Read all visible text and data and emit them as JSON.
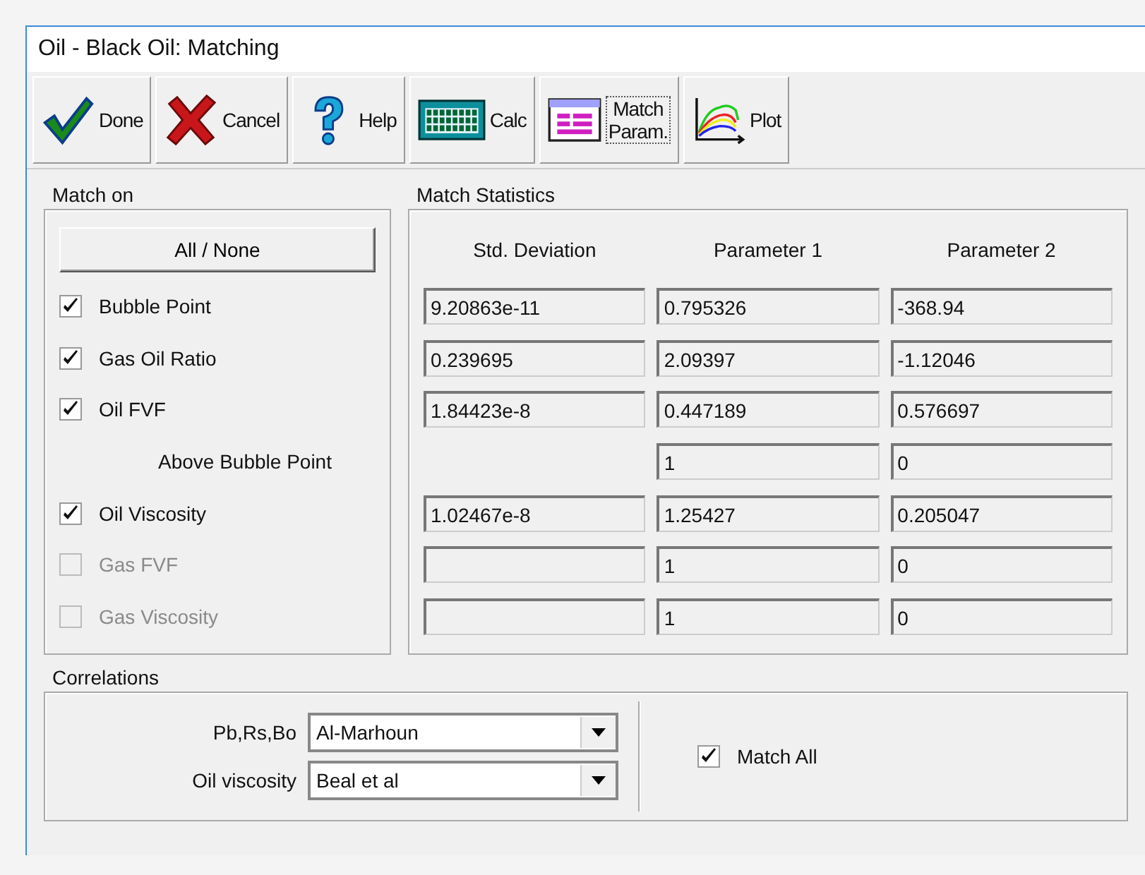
{
  "window": {
    "title": "Oil - Black Oil: Matching"
  },
  "toolbar": [
    {
      "kind": "done",
      "label": "Done"
    },
    {
      "kind": "cancel",
      "label": "Cancel"
    },
    {
      "kind": "help",
      "label": "Help"
    },
    {
      "kind": "calc",
      "label": "Calc"
    },
    {
      "kind": "param",
      "label_lines": [
        "Match",
        "Param."
      ]
    },
    {
      "kind": "plot",
      "label": "Plot"
    }
  ],
  "match_on": {
    "title": "Match on",
    "all_none_button": "All / None",
    "items": [
      {
        "kind": "checkbox",
        "label": "Bubble Point",
        "checked": true,
        "disabled": false
      },
      {
        "kind": "checkbox",
        "label": "Gas Oil Ratio",
        "checked": true,
        "disabled": false
      },
      {
        "kind": "checkbox",
        "label": "Oil FVF",
        "checked": true,
        "disabled": false
      },
      {
        "kind": "note",
        "label": "Above Bubble Point"
      },
      {
        "kind": "checkbox",
        "label": "Oil Viscosity",
        "checked": true,
        "disabled": false
      },
      {
        "kind": "checkbox",
        "label": "Gas FVF",
        "checked": false,
        "disabled": true
      },
      {
        "kind": "checkbox",
        "label": "Gas Viscosity",
        "checked": false,
        "disabled": true
      }
    ]
  },
  "match_statistics": {
    "title": "Match Statistics",
    "columns": [
      "Std. Deviation",
      "Parameter 1",
      "Parameter 2"
    ],
    "rows": [
      {
        "cells": [
          {
            "kind": "field",
            "value": "9.20863e-11"
          },
          {
            "kind": "field",
            "value": "0.795326"
          },
          {
            "kind": "field",
            "value": "-368.94"
          }
        ]
      },
      {
        "cells": [
          {
            "kind": "field",
            "value": "0.239695"
          },
          {
            "kind": "field",
            "value": "2.09397"
          },
          {
            "kind": "field",
            "value": "-1.12046"
          }
        ]
      },
      {
        "cells": [
          {
            "kind": "field",
            "value": "1.84423e-8"
          },
          {
            "kind": "field",
            "value": "0.447189"
          },
          {
            "kind": "field",
            "value": "0.576697"
          }
        ]
      },
      {
        "cells": [
          {
            "kind": "none"
          },
          {
            "kind": "field",
            "value": "1"
          },
          {
            "kind": "field",
            "value": "0"
          }
        ]
      },
      {
        "cells": [
          {
            "kind": "field",
            "value": "1.02467e-8"
          },
          {
            "kind": "field",
            "value": "1.25427"
          },
          {
            "kind": "field",
            "value": "0.205047"
          }
        ]
      },
      {
        "cells": [
          {
            "kind": "field"
          },
          {
            "kind": "field",
            "value": "1"
          },
          {
            "kind": "field",
            "value": "0"
          }
        ]
      },
      {
        "cells": [
          {
            "kind": "field"
          },
          {
            "kind": "field",
            "value": "1"
          },
          {
            "kind": "field",
            "value": "0"
          }
        ]
      }
    ]
  },
  "correlations": {
    "title": "Correlations",
    "selects": [
      {
        "label": "Pb,Rs,Bo",
        "value": "Al-Marhoun"
      },
      {
        "label": "Oil viscosity",
        "value": "Beal et al"
      }
    ],
    "match_all": {
      "label": "Match All",
      "checked": true
    }
  }
}
